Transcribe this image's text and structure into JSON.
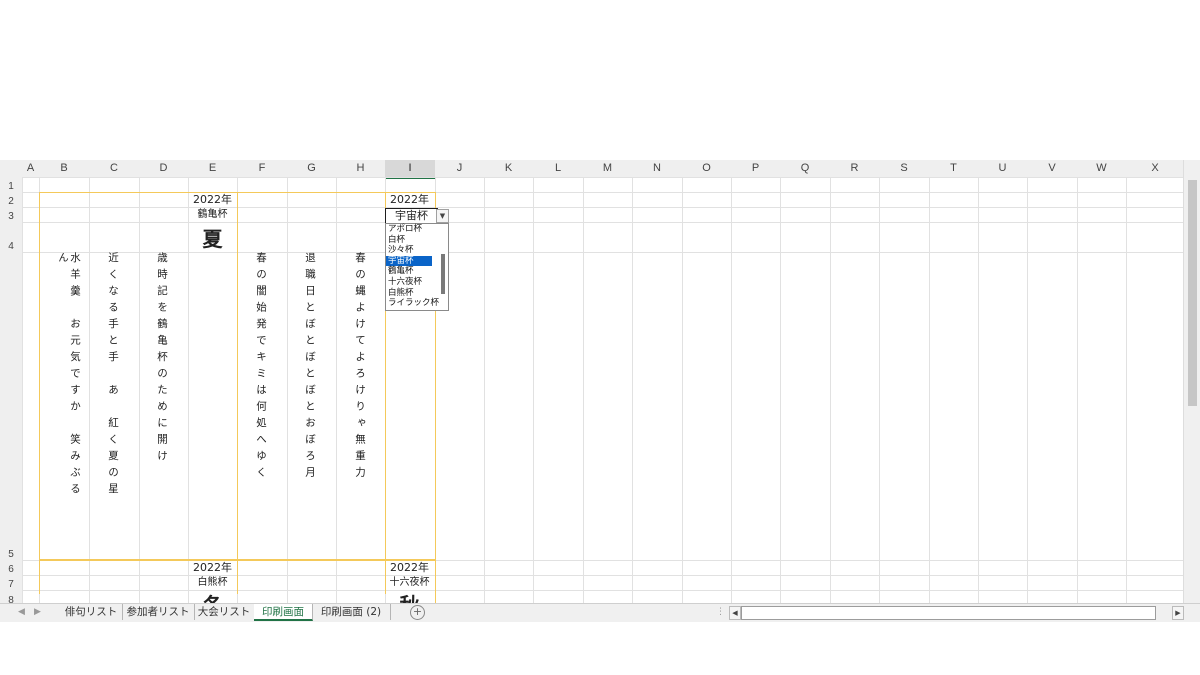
{
  "columns": [
    "A",
    "B",
    "C",
    "D",
    "E",
    "F",
    "G",
    "H",
    "I",
    "J",
    "K",
    "L",
    "M",
    "N",
    "O",
    "P",
    "Q",
    "R",
    "S",
    "T",
    "U",
    "V",
    "W",
    "X"
  ],
  "rows": [
    "1",
    "2",
    "3",
    "4",
    "5",
    "6",
    "7",
    "8"
  ],
  "selected_column": "I",
  "cells": {
    "E2": "2022年",
    "E3": "鶴亀杯",
    "E4": "夏",
    "I2": "2022年",
    "I3": "宇宙杯",
    "E6": "2022年",
    "E7": "白熊杯",
    "E8": "冬",
    "I6": "2022年",
    "I7": "十六夜杯",
    "I8": "秋"
  },
  "haiku": {
    "B": "水羊羹　お元気ですか　笑みぶるん",
    "C": "近くなる手と手　あ　紅く夏の星",
    "D": "歳時記を鶴亀杯のために開け",
    "F": "春の闇始発でキミは何処へゆく",
    "G": "退職日とぼとぼとぼとおぼろ月",
    "H": "春の蝿よけてよろけりゃ無重力"
  },
  "dropdown": {
    "selected": "宇宙杯",
    "arrow_icon": "dropdown-arrow-icon",
    "options": [
      "アポロ杯",
      "白杯",
      "沙々杯",
      "宇宙杯",
      "鶴亀杯",
      "十六夜杯",
      "白熊杯",
      "ライラック杯"
    ],
    "active_index": 3,
    "highlight_color": "#0a64c8"
  },
  "tabs": {
    "items": [
      "俳句リスト",
      "参加者リスト",
      "大会リスト",
      "印刷画面",
      "印刷画面 (2)"
    ],
    "active_index": 3,
    "accent_color": "#217346",
    "add_icon": "plus-circle-icon"
  },
  "frame_color": "#f4c95a"
}
